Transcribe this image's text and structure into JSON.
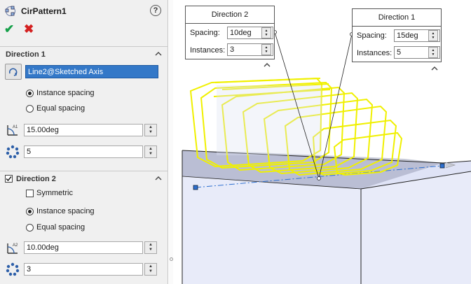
{
  "feature": {
    "title": "CirPattern1"
  },
  "direction1": {
    "header": "Direction 1",
    "axis": "Line2@Sketched Axis",
    "option_instance": "Instance spacing",
    "option_equal": "Equal spacing",
    "selected_option": "instance",
    "angle": "15.00deg",
    "instances": "5"
  },
  "direction2": {
    "header": "Direction 2",
    "enabled": true,
    "symmetric_label": "Symmetric",
    "symmetric_checked": false,
    "option_instance": "Instance spacing",
    "option_equal": "Equal spacing",
    "selected_option": "instance",
    "angle": "10.00deg",
    "instances": "3"
  },
  "callouts": {
    "direction2": {
      "title": "Direction 2",
      "spacing_label": "Spacing:",
      "spacing_value": "10deg",
      "instances_label": "Instances:",
      "instances_value": "3"
    },
    "direction1": {
      "title": "Direction 1",
      "spacing_label": "Spacing:",
      "spacing_value": "15deg",
      "instances_label": "Instances:",
      "instances_value": "5"
    }
  },
  "colors": {
    "accent": "#3378c8",
    "ok": "#16a04a",
    "cancel": "#d42020",
    "preview": "#f0f000",
    "body_face": "#dfe3f6"
  }
}
